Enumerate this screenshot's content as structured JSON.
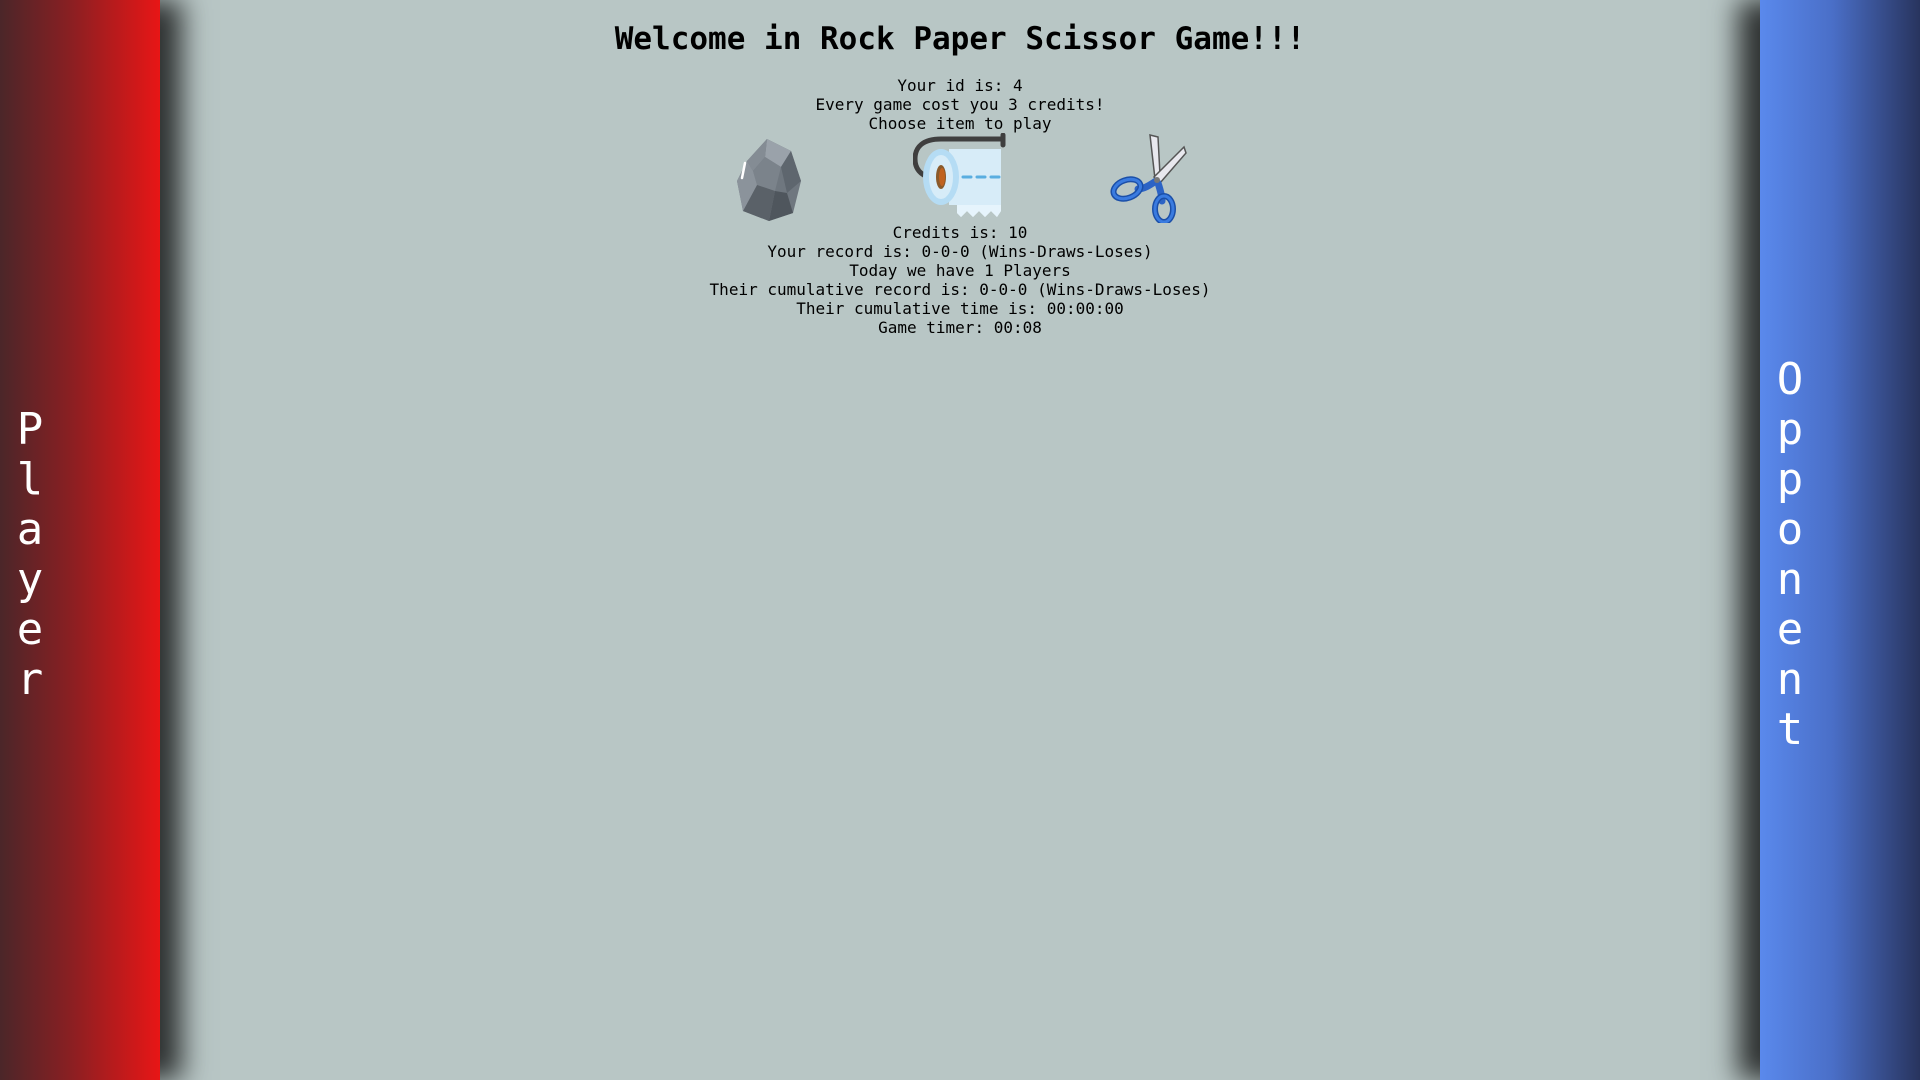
{
  "left_panel": {
    "label": "Player"
  },
  "right_panel": {
    "label": "Opponent"
  },
  "title": "Welcome in Rock Paper Scissor Game!!!",
  "info": {
    "id_line": "Your id is: 4",
    "cost_line": "Every game cost you 3 credits!",
    "choose_line": "Choose item to play"
  },
  "choices": [
    {
      "name": "rock",
      "icon": "rock-icon"
    },
    {
      "name": "paper",
      "icon": "toilet-paper-icon"
    },
    {
      "name": "scissors",
      "icon": "scissors-icon"
    }
  ],
  "stats": {
    "credits": "Credits is: 10",
    "record": "Your record is: 0-0-0 (Wins-Draws-Loses)",
    "players": "Today we have 1 Players",
    "cumulative_record": "Their cumulative record is: 0-0-0 (Wins-Draws-Loses)",
    "cumulative_time": "Their cumulative time is: 00:00:00",
    "timer": "Game timer: 00:08"
  },
  "colors": {
    "background": "#b8c6c5",
    "player_panel": "#e81616",
    "opponent_panel": "#5a89ec"
  }
}
